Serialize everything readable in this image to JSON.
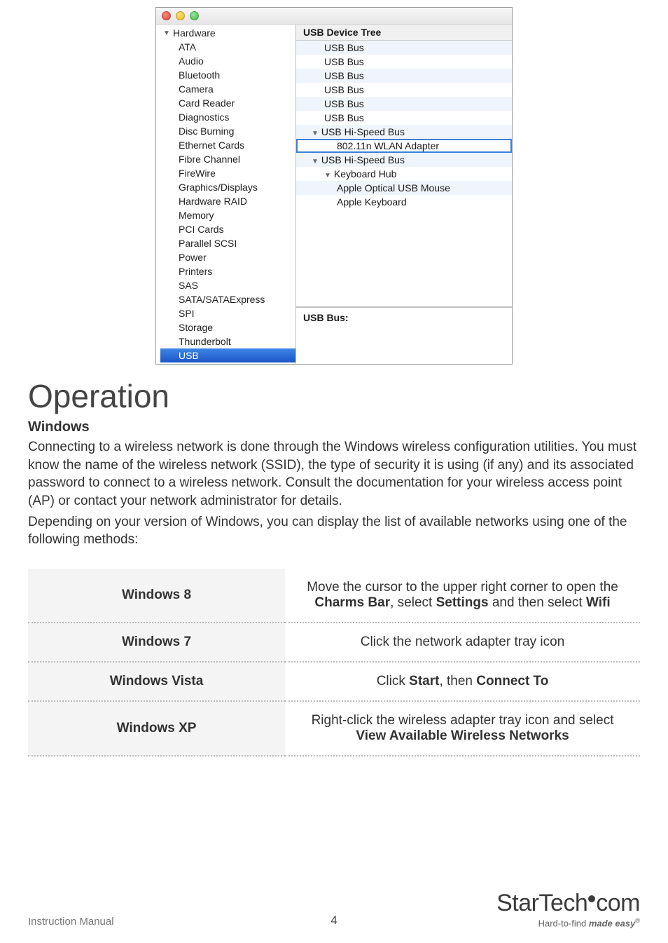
{
  "screenshot": {
    "sidebar": {
      "header": "Hardware",
      "items": [
        "ATA",
        "Audio",
        "Bluetooth",
        "Camera",
        "Card Reader",
        "Diagnostics",
        "Disc Burning",
        "Ethernet Cards",
        "Fibre Channel",
        "FireWire",
        "Graphics/Displays",
        "Hardware RAID",
        "Memory",
        "PCI Cards",
        "Parallel SCSI",
        "Power",
        "Printers",
        "SAS",
        "SATA/SATAExpress",
        "SPI",
        "Storage",
        "Thunderbolt",
        "USB"
      ],
      "selected": "USB"
    },
    "content": {
      "header": "USB Device Tree",
      "rows": [
        {
          "label": "USB Bus",
          "level": 1,
          "alt": true
        },
        {
          "label": "USB Bus",
          "level": 1,
          "alt": false
        },
        {
          "label": "USB Bus",
          "level": 1,
          "alt": true
        },
        {
          "label": "USB Bus",
          "level": 1,
          "alt": false
        },
        {
          "label": "USB Bus",
          "level": 1,
          "alt": true
        },
        {
          "label": "USB Bus",
          "level": 1,
          "alt": false
        },
        {
          "label": "USB Hi-Speed Bus",
          "level": 0,
          "alt": true,
          "expand": true
        },
        {
          "label": "802.11n WLAN Adapter",
          "level": 2,
          "alt": false,
          "selected": true
        },
        {
          "label": "USB Hi-Speed Bus",
          "level": 0,
          "alt": true,
          "expand": true
        },
        {
          "label": "Keyboard Hub",
          "level": 1,
          "alt": false,
          "expand": true
        },
        {
          "label": "Apple Optical USB Mouse",
          "level": 2,
          "alt": true
        },
        {
          "label": "Apple Keyboard",
          "level": 2,
          "alt": false
        }
      ],
      "detail_label": "USB Bus:"
    }
  },
  "section_title": "Operation",
  "windows_heading": "Windows",
  "para1": "Connecting to a wireless network is done through the Windows wireless configuration utilities. You must know the name of the wireless network (SSID), the type of security it is using (if any) and its associated password to connect to a wireless network. Consult the documentation for your wireless access point (AP) or contact your network administrator for details.",
  "para2": "Depending on your version of Windows, you can display the list of available networks using one of the following methods:",
  "table": {
    "rows": [
      {
        "os": "Windows 8",
        "pre": "Move the cursor to the upper right corner to open the ",
        "b1": "Charms Bar",
        "mid": ", select ",
        "b2": "Settings",
        "mid2": " and then select ",
        "b3": "Wifi"
      },
      {
        "os": "Windows 7",
        "plain": "Click the network adapter tray icon"
      },
      {
        "os": "Windows Vista",
        "pre": "Click ",
        "b1": "Start",
        "mid": ", then ",
        "b2": "Connect To"
      },
      {
        "os": "Windows XP",
        "pre": "Right-click the wireless adapter tray icon and select ",
        "b1": "View Available Wireless Networks"
      }
    ]
  },
  "footer": {
    "left": "Instruction Manual",
    "page": "4",
    "brand_a": "Star",
    "brand_b": "Tech",
    "brand_c": "com",
    "tag_a": "Hard-to-find ",
    "tag_b": "made easy"
  }
}
